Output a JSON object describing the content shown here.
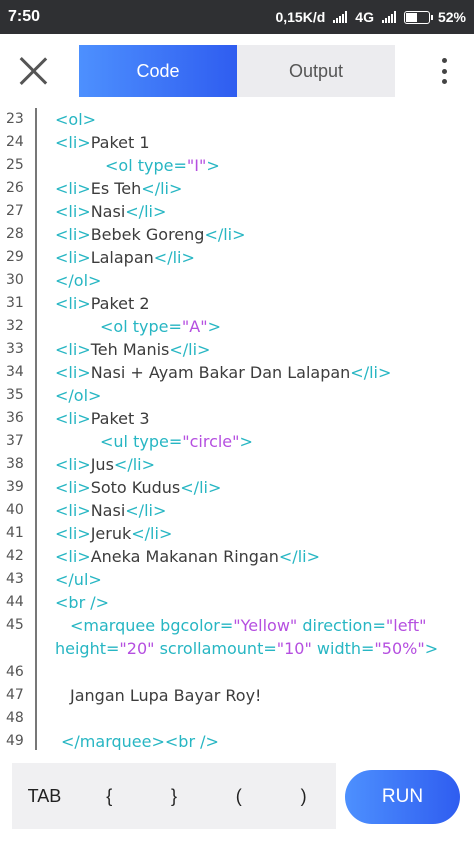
{
  "status_bar": {
    "time": "7:50",
    "speed": "0,15K/d",
    "network": "4G",
    "battery_percent": "52%",
    "battery_level": 0.52
  },
  "toolbar": {
    "tabs": [
      {
        "label": "Code",
        "active": true
      },
      {
        "label": "Output",
        "active": false
      }
    ]
  },
  "editor": {
    "lines": [
      {
        "n": "23",
        "indent": 0,
        "parts": [
          [
            "tag",
            "<ol>"
          ]
        ]
      },
      {
        "n": "24",
        "indent": 0,
        "parts": [
          [
            "tag",
            "<li>"
          ],
          [
            "txt",
            "Paket 1"
          ]
        ]
      },
      {
        "n": "25",
        "indent": 1,
        "parts": [
          [
            "tag",
            "<ol "
          ],
          [
            "attr",
            "type="
          ],
          [
            "val",
            "\"I\""
          ],
          [
            "tag",
            ">"
          ]
        ]
      },
      {
        "n": "26",
        "indent": 0,
        "parts": [
          [
            "tag",
            "<li>"
          ],
          [
            "txt",
            "Es Teh"
          ],
          [
            "tag",
            "</li>"
          ]
        ]
      },
      {
        "n": "27",
        "indent": 0,
        "parts": [
          [
            "tag",
            "<li>"
          ],
          [
            "txt",
            "Nasi"
          ],
          [
            "tag",
            "</li>"
          ]
        ]
      },
      {
        "n": "28",
        "indent": 0,
        "parts": [
          [
            "tag",
            "<li>"
          ],
          [
            "txt",
            "Bebek Goreng"
          ],
          [
            "tag",
            "</li>"
          ]
        ]
      },
      {
        "n": "29",
        "indent": 0,
        "parts": [
          [
            "tag",
            "<li>"
          ],
          [
            "txt",
            "Lalapan"
          ],
          [
            "tag",
            "</li>"
          ]
        ]
      },
      {
        "n": "30",
        "indent": 0,
        "parts": [
          [
            "tag",
            "</ol>"
          ]
        ]
      },
      {
        "n": "31",
        "indent": 0,
        "parts": [
          [
            "tag",
            "<li>"
          ],
          [
            "txt",
            "Paket 2"
          ]
        ]
      },
      {
        "n": "32",
        "indent": 2,
        "parts": [
          [
            "tag",
            "<ol "
          ],
          [
            "attr",
            "type="
          ],
          [
            "val",
            "\"A\""
          ],
          [
            "tag",
            ">"
          ]
        ]
      },
      {
        "n": "33",
        "indent": 0,
        "parts": [
          [
            "tag",
            "<li>"
          ],
          [
            "txt",
            "Teh Manis"
          ],
          [
            "tag",
            "</li>"
          ]
        ]
      },
      {
        "n": "34",
        "indent": 0,
        "parts": [
          [
            "tag",
            "<li>"
          ],
          [
            "txt",
            "Nasi + Ayam Bakar Dan Lalapan"
          ],
          [
            "tag",
            "</li>"
          ]
        ]
      },
      {
        "n": "35",
        "indent": 0,
        "parts": [
          [
            "tag",
            "</ol>"
          ]
        ]
      },
      {
        "n": "36",
        "indent": 0,
        "parts": [
          [
            "tag",
            "<li>"
          ],
          [
            "txt",
            "Paket 3"
          ]
        ]
      },
      {
        "n": "37",
        "indent": 2,
        "parts": [
          [
            "tag",
            "<ul "
          ],
          [
            "attr",
            "type="
          ],
          [
            "val",
            "\"circle\""
          ],
          [
            "tag",
            ">"
          ]
        ]
      },
      {
        "n": "38",
        "indent": 0,
        "parts": [
          [
            "tag",
            "<li>"
          ],
          [
            "txt",
            "Jus"
          ],
          [
            "tag",
            "</li>"
          ]
        ]
      },
      {
        "n": "39",
        "indent": 0,
        "parts": [
          [
            "tag",
            "<li>"
          ],
          [
            "txt",
            "Soto Kudus"
          ],
          [
            "tag",
            "</li>"
          ]
        ]
      },
      {
        "n": "40",
        "indent": 0,
        "parts": [
          [
            "tag",
            "<li>"
          ],
          [
            "txt",
            "Nasi"
          ],
          [
            "tag",
            "</li>"
          ]
        ]
      },
      {
        "n": "41",
        "indent": 0,
        "parts": [
          [
            "tag",
            "<li>"
          ],
          [
            "txt",
            "Jeruk"
          ],
          [
            "tag",
            "</li>"
          ]
        ]
      },
      {
        "n": "42",
        "indent": 0,
        "parts": [
          [
            "tag",
            "<li>"
          ],
          [
            "txt",
            "Aneka Makanan Ringan"
          ],
          [
            "tag",
            "</li>"
          ]
        ]
      },
      {
        "n": "43",
        "indent": 0,
        "parts": [
          [
            "tag",
            "</ul>"
          ]
        ]
      },
      {
        "n": "44",
        "indent": 0,
        "parts": [
          [
            "tag",
            "<br />"
          ]
        ]
      },
      {
        "n": "45",
        "indent": 3,
        "parts": [
          [
            "tag",
            "<marquee "
          ],
          [
            "attr",
            "bgcolor="
          ],
          [
            "val",
            "\"Yellow\""
          ],
          [
            "attr",
            " direction="
          ],
          [
            "val",
            "\"left\""
          ]
        ]
      },
      {
        "n": "",
        "indent": 0,
        "parts": [
          [
            "attr",
            "height="
          ],
          [
            "val",
            "\"20\""
          ],
          [
            "attr",
            " scrollamount="
          ],
          [
            "val",
            "\"10\""
          ],
          [
            "attr",
            " width="
          ],
          [
            "val",
            "\"50%\""
          ],
          [
            "tag",
            ">"
          ]
        ]
      },
      {
        "n": "46",
        "indent": 0,
        "parts": []
      },
      {
        "n": "47",
        "indent": 4,
        "parts": [
          [
            "txt",
            "Jangan Lupa Bayar Roy!"
          ]
        ]
      },
      {
        "n": "48",
        "indent": 0,
        "parts": []
      },
      {
        "n": "49",
        "indent": 5,
        "parts": [
          [
            "tag",
            "</marquee>"
          ],
          [
            "tag",
            "<br />"
          ]
        ]
      }
    ]
  },
  "keybar": {
    "keys": [
      "TAB",
      "{",
      "}",
      "(",
      ")"
    ],
    "run_label": "RUN"
  }
}
